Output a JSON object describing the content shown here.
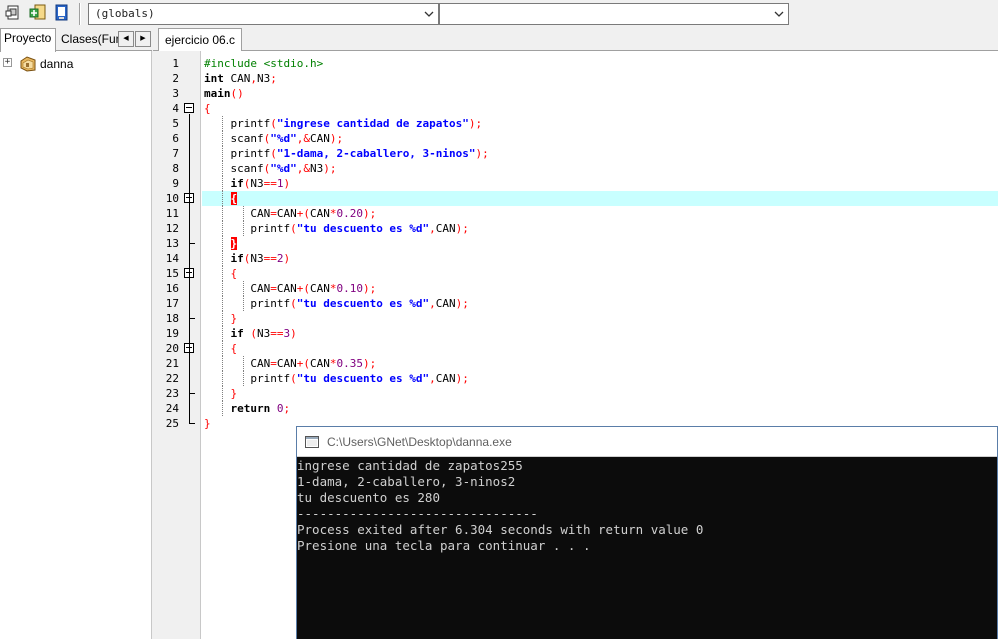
{
  "toolbar": {
    "icons": [
      "window-icon",
      "add-file-icon",
      "project-icon"
    ],
    "combo1_value": "(globals)",
    "combo2_value": ""
  },
  "left_panel": {
    "tabs": [
      {
        "label": "Proyecto",
        "active": true
      },
      {
        "label": "Clases(Fun",
        "active": false
      }
    ],
    "tree": [
      {
        "label": "danna",
        "expander": "+"
      }
    ]
  },
  "editor": {
    "tab_label": "ejercicio 06.c",
    "highlighted_line": 10,
    "lines": [
      {
        "n": "1"
      },
      {
        "n": "2"
      },
      {
        "n": "3"
      },
      {
        "n": "4"
      },
      {
        "n": "5"
      },
      {
        "n": "6"
      },
      {
        "n": "7"
      },
      {
        "n": "8"
      },
      {
        "n": "9"
      },
      {
        "n": "10"
      },
      {
        "n": "11"
      },
      {
        "n": "12"
      },
      {
        "n": "13"
      },
      {
        "n": "14"
      },
      {
        "n": "15"
      },
      {
        "n": "16"
      },
      {
        "n": "17"
      },
      {
        "n": "18"
      },
      {
        "n": "19"
      },
      {
        "n": "20"
      },
      {
        "n": "21"
      },
      {
        "n": "22"
      },
      {
        "n": "23"
      },
      {
        "n": "24"
      },
      {
        "n": "25"
      }
    ],
    "code": [
      "#include <stdio.h>",
      "int CAN,N3;",
      "main()",
      "{",
      "    printf(\"ingrese cantidad de zapatos\");",
      "    scanf(\"%d\",&CAN);",
      "    printf(\"1-dama, 2-caballero, 3-ninos\");",
      "    scanf(\"%d\",&N3);",
      "    if(N3==1)",
      "    {",
      "       CAN=CAN+(CAN*0.20);",
      "       printf(\"tu descuento es %d\",CAN);",
      "    }",
      "    if(N3==2)",
      "    {",
      "       CAN=CAN+(CAN*0.10);",
      "       printf(\"tu descuento es %d\",CAN);",
      "    }",
      "    if (N3==3)",
      "    {",
      "       CAN=CAN+(CAN*0.35);",
      "       printf(\"tu descuento es %d\",CAN);",
      "    }",
      "    return 0;",
      "}"
    ]
  },
  "console": {
    "title": "C:\\Users\\GNet\\Desktop\\danna.exe",
    "lines": [
      "ingrese cantidad de zapatos255",
      "1-dama, 2-caballero, 3-ninos2",
      "tu descuento es 280",
      "--------------------------------",
      "Process exited after 6.304 seconds with return value 0",
      "Presione una tecla para continuar . . ."
    ]
  },
  "colors": {
    "keyword": "#000000",
    "preprocessor": "#008000",
    "string": "#0000ff",
    "number": "#800080",
    "symbol": "#ff0000",
    "current_line": "#c8ffff",
    "console_bg": "#0c0c0c",
    "console_fg": "#d0d0d0"
  }
}
